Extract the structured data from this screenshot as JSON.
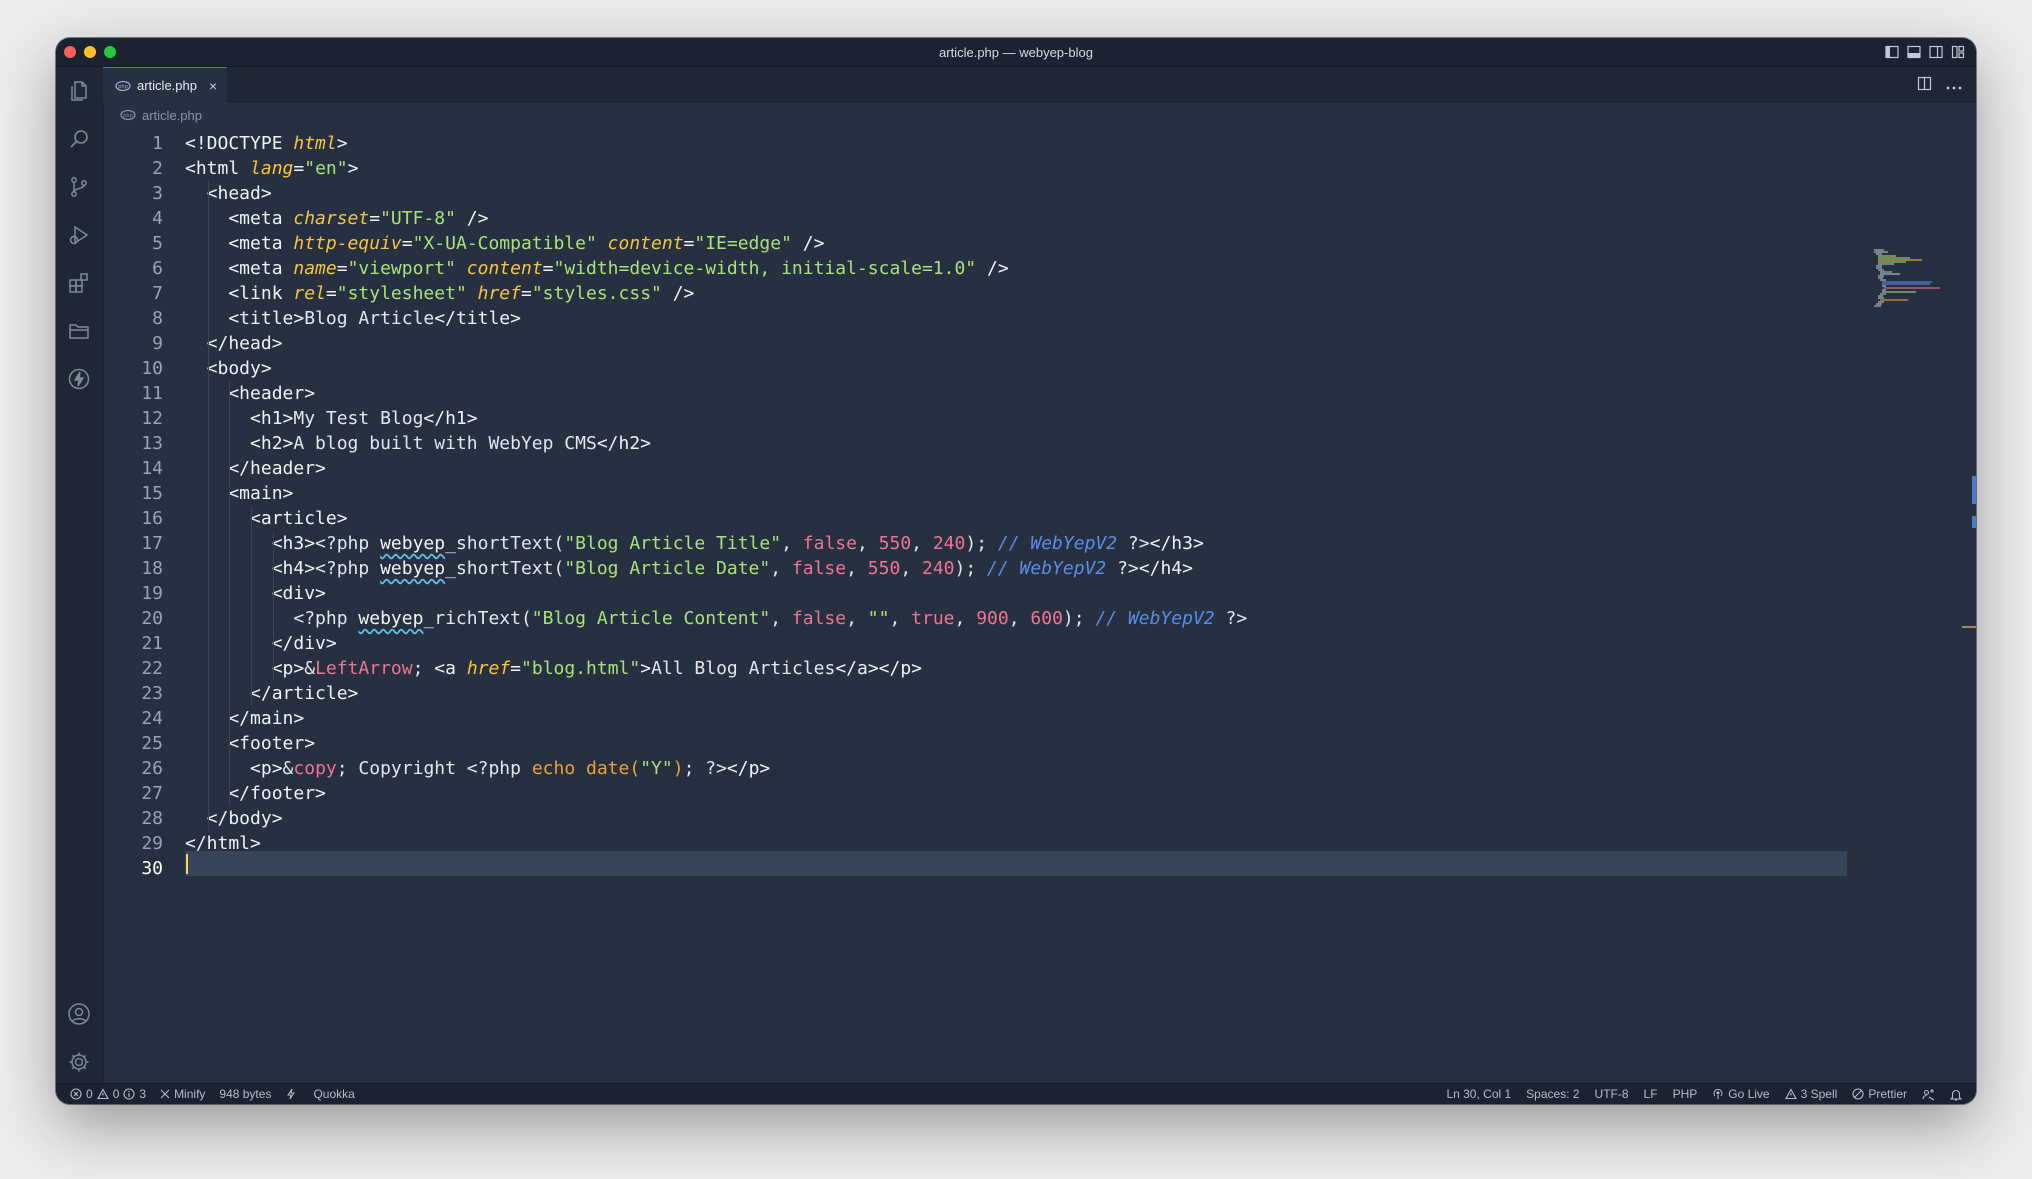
{
  "window": {
    "title": "article.php — webyep-blog"
  },
  "tab": {
    "label": "article.php",
    "close": "×"
  },
  "breadcrumb": {
    "file": "article.php"
  },
  "editor": {
    "active_line": 30,
    "lines": [
      [
        [
          "tag",
          "<!DOCTYPE "
        ],
        [
          "attr",
          "html"
        ],
        [
          "tag",
          ">"
        ]
      ],
      [
        [
          "tag",
          "<html "
        ],
        [
          "attr",
          "lang"
        ],
        [
          "tag",
          "="
        ],
        [
          "str",
          "\"en\""
        ],
        [
          "tag",
          ">"
        ]
      ],
      [
        [
          "tag",
          "  <head>"
        ]
      ],
      [
        [
          "tag",
          "    <meta "
        ],
        [
          "attr",
          "charset"
        ],
        [
          "tag",
          "="
        ],
        [
          "str",
          "\"UTF-8\""
        ],
        [
          "tag",
          " />"
        ]
      ],
      [
        [
          "tag",
          "    <meta "
        ],
        [
          "attr",
          "http-equiv"
        ],
        [
          "tag",
          "="
        ],
        [
          "str",
          "\"X-UA-Compatible\""
        ],
        [
          "tag",
          " "
        ],
        [
          "attr",
          "content"
        ],
        [
          "tag",
          "="
        ],
        [
          "str",
          "\"IE=edge\""
        ],
        [
          "tag",
          " />"
        ]
      ],
      [
        [
          "tag",
          "    <meta "
        ],
        [
          "attr",
          "name"
        ],
        [
          "tag",
          "="
        ],
        [
          "str",
          "\"viewport\""
        ],
        [
          "tag",
          " "
        ],
        [
          "attr",
          "content"
        ],
        [
          "tag",
          "="
        ],
        [
          "str",
          "\"width=device-width, initial-scale=1.0\""
        ],
        [
          "tag",
          " />"
        ]
      ],
      [
        [
          "tag",
          "    <link "
        ],
        [
          "attr",
          "rel"
        ],
        [
          "tag",
          "="
        ],
        [
          "str",
          "\"stylesheet\""
        ],
        [
          "tag",
          " "
        ],
        [
          "attr",
          "href"
        ],
        [
          "tag",
          "="
        ],
        [
          "str",
          "\"styles.css\""
        ],
        [
          "tag",
          " />"
        ]
      ],
      [
        [
          "tag",
          "    <title>"
        ],
        [
          "plain",
          "Blog Article"
        ],
        [
          "tag",
          "</title>"
        ]
      ],
      [
        [
          "tag",
          "  </head>"
        ]
      ],
      [
        [
          "tag",
          "  <body>"
        ]
      ],
      [
        [
          "tag",
          "    <header>"
        ]
      ],
      [
        [
          "tag",
          "      <h1>"
        ],
        [
          "plain",
          "My Test Blog"
        ],
        [
          "tag",
          "</h1>"
        ]
      ],
      [
        [
          "tag",
          "      <h2>"
        ],
        [
          "plain",
          "A blog built with WebYep CMS"
        ],
        [
          "tag",
          "</h2>"
        ]
      ],
      [
        [
          "tag",
          "    </header>"
        ]
      ],
      [
        [
          "tag",
          "    <main>"
        ]
      ],
      [
        [
          "tag",
          "      <article>"
        ]
      ],
      [
        [
          "tag",
          "        <h3>"
        ],
        [
          "plain",
          "<?php "
        ],
        [
          "fn",
          "webyep"
        ],
        [
          "plain",
          "_shortText("
        ],
        [
          "str",
          "\"Blog Article Title\""
        ],
        [
          "plain",
          ", "
        ],
        [
          "kw",
          "false"
        ],
        [
          "plain",
          ", "
        ],
        [
          "num",
          "550"
        ],
        [
          "plain",
          ", "
        ],
        [
          "num",
          "240"
        ],
        [
          "plain",
          "); "
        ],
        [
          "cmt",
          "// WebYepV2"
        ],
        [
          "plain",
          " ?>"
        ],
        [
          "tag",
          "</h3>"
        ]
      ],
      [
        [
          "tag",
          "        <h4>"
        ],
        [
          "plain",
          "<?php "
        ],
        [
          "fn",
          "webyep"
        ],
        [
          "plain",
          "_shortText("
        ],
        [
          "str",
          "\"Blog Article Date\""
        ],
        [
          "plain",
          ", "
        ],
        [
          "kw",
          "false"
        ],
        [
          "plain",
          ", "
        ],
        [
          "num",
          "550"
        ],
        [
          "plain",
          ", "
        ],
        [
          "num",
          "240"
        ],
        [
          "plain",
          "); "
        ],
        [
          "cmt",
          "// WebYepV2"
        ],
        [
          "plain",
          " ?>"
        ],
        [
          "tag",
          "</h4>"
        ]
      ],
      [
        [
          "tag",
          "        <div>"
        ]
      ],
      [
        [
          "plain",
          "          <?php "
        ],
        [
          "fn",
          "webyep"
        ],
        [
          "plain",
          "_richText("
        ],
        [
          "str",
          "\"Blog Article Content\""
        ],
        [
          "plain",
          ", "
        ],
        [
          "kw",
          "false"
        ],
        [
          "plain",
          ", "
        ],
        [
          "str",
          "\"\""
        ],
        [
          "plain",
          ", "
        ],
        [
          "kw",
          "true"
        ],
        [
          "plain",
          ", "
        ],
        [
          "num",
          "900"
        ],
        [
          "plain",
          ", "
        ],
        [
          "num",
          "600"
        ],
        [
          "plain",
          "); "
        ],
        [
          "cmt",
          "// WebYepV2"
        ],
        [
          "plain",
          " ?>"
        ]
      ],
      [
        [
          "tag",
          "        </div>"
        ]
      ],
      [
        [
          "tag",
          "        <p>"
        ],
        [
          "plain",
          "&"
        ],
        [
          "ent",
          "LeftArrow"
        ],
        [
          "plain",
          "; "
        ],
        [
          "tag",
          "<a "
        ],
        [
          "attr",
          "href"
        ],
        [
          "tag",
          "="
        ],
        [
          "str",
          "\"blog.html\""
        ],
        [
          "tag",
          ">"
        ],
        [
          "plain",
          "All Blog Articles"
        ],
        [
          "tag",
          "</a></p>"
        ]
      ],
      [
        [
          "tag",
          "      </article>"
        ]
      ],
      [
        [
          "tag",
          "    </main>"
        ]
      ],
      [
        [
          "tag",
          "    <footer>"
        ]
      ],
      [
        [
          "tag",
          "      <p>"
        ],
        [
          "plain",
          "&"
        ],
        [
          "ent",
          "copy"
        ],
        [
          "plain",
          "; Copyright <?php "
        ],
        [
          "echo",
          "echo date("
        ],
        [
          "str",
          "\"Y\""
        ],
        [
          "echo",
          ")"
        ],
        [
          "plain",
          "; ?>"
        ],
        [
          "tag",
          "</p>"
        ]
      ],
      [
        [
          "tag",
          "    </footer>"
        ]
      ],
      [
        [
          "tag",
          "  </body>"
        ]
      ],
      [
        [
          "tag",
          "</html>"
        ]
      ],
      []
    ]
  },
  "statusbar": {
    "errors": "0",
    "warnings": "0",
    "info": "3",
    "minify": "Minify",
    "size": "948 bytes",
    "quokka": "Quokka",
    "position": "Ln 30, Col 1",
    "spaces": "Spaces: 2",
    "encoding": "UTF-8",
    "eol": "LF",
    "language": "PHP",
    "golive": "Go Live",
    "spell": "3 Spell",
    "prettier": "Prettier"
  },
  "icons": {
    "activity": [
      "files-icon",
      "search-icon",
      "source-control-icon",
      "run-debug-icon",
      "extensions-icon",
      "folder-icon",
      "lightning-icon",
      "account-icon",
      "settings-gear-icon"
    ]
  },
  "colors": {
    "editor_bg": "#263041",
    "tag": "#f0f2f5",
    "attribute": "#f5c542",
    "string": "#a9e27a",
    "number": "#f07590",
    "comment": "#5a8de6",
    "cursor": "#ffcc66"
  }
}
